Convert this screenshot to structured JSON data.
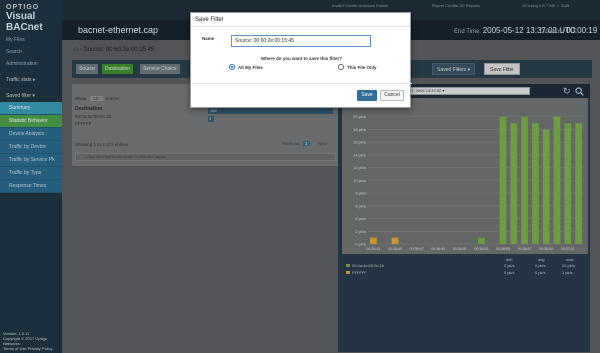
{
  "app": {
    "brand": "OPTIGO",
    "product": "Visual BACnet"
  },
  "topbar": {
    "info": [
      "Invalid Credits  Unknown Invalid",
      "Report Credits: 20 Reports",
      "10 Using 4 B 7 ME ✓ SUB"
    ]
  },
  "sidebar": {
    "items": [
      {
        "label": "My Files",
        "type": "nav"
      },
      {
        "label": "Search",
        "type": "nav"
      },
      {
        "label": "Administration",
        "type": "nav"
      },
      {
        "label": "Traffic stats ▸",
        "type": "section"
      },
      {
        "label": "Saved filter ▾",
        "type": "section"
      },
      {
        "label": "Summary",
        "type": "sub"
      },
      {
        "label": "Statistic Behavior",
        "type": "sub-green"
      },
      {
        "label": "Device Analysis",
        "type": "sub"
      },
      {
        "label": "Traffic by Device",
        "type": "sub"
      },
      {
        "label": "Traffic by Service Pk",
        "type": "sub"
      },
      {
        "label": "Traffic by Type",
        "type": "sub"
      },
      {
        "label": "Response Times",
        "type": "sub"
      }
    ],
    "footer": [
      "Version: 1.0.11",
      "Copyright © 2017 Optigo Networks",
      "Terms of Use Privacy Policy"
    ]
  },
  "file": {
    "name": "bacnet-ethernet.cap",
    "end_time_label": "End Time:",
    "end_time": "2005-05-12 13:37:02 UTC",
    "duration_label": "Duration:",
    "duration": "00:00:19"
  },
  "breadcrumb": {
    "text": "Source: 00:60:2e:00:15:45"
  },
  "tabs": [
    {
      "label": "Source",
      "selected": false
    },
    {
      "label": "Destination",
      "selected": true
    },
    {
      "label": "Service Choice",
      "selected": false
    }
  ],
  "toolbar": {
    "saved_filters": "Saved Filters ▾",
    "save_filter": "Save Filter"
  },
  "left_panel": {
    "show_prefix": "Show",
    "show_value": "10",
    "show_suffix": "entries",
    "header": "Destination",
    "rows": [
      "00:0a:4e:00:0c:1b",
      "FFFFFF"
    ],
    "col2_header": "Count",
    "col2_rows": [
      "159",
      "3"
    ],
    "footer": "Showing 1 to 2 of 2 entries",
    "pager": {
      "prev": "Previous",
      "page": "1",
      "next": "Next"
    },
    "filter_hint": "Click on a row to drill down or filter the report"
  },
  "chart_panel": {
    "date_range": "▦  May 12, 2005 13:36:43 - May 12, 2005 13:37:02 ▾",
    "legend": [
      {
        "label": "00:0a:4e:00:0c:1b",
        "color": "#7aa84a"
      },
      {
        "label": "FFFFFF",
        "color": "#d7a53a"
      }
    ],
    "stats_headers": [
      "min",
      "avg",
      "max"
    ],
    "stats_rows": [
      [
        "0 pk/s",
        "9 pk/s",
        "20 pk/s"
      ],
      [
        "0 pk/s",
        "0 pk/s",
        "1 pk/s"
      ]
    ]
  },
  "chart_data": {
    "type": "bar",
    "categories": [
      "13:36:43",
      "13:36:44",
      "13:36:45",
      "13:36:46",
      "13:36:47",
      "13:36:48",
      "13:36:49",
      "13:36:50",
      "13:36:51",
      "13:36:52",
      "13:36:53",
      "13:36:54",
      "13:36:55",
      "13:36:56",
      "13:36:57",
      "13:36:58",
      "13:36:59",
      "13:37:00",
      "13:37:01",
      "13:37:02"
    ],
    "x_tick_labels": [
      "00:36:43",
      "00:36:45",
      "00:36:47",
      "00:36:49",
      "00:36:51",
      "00:36:53",
      "00:36:55",
      "00:36:57",
      "00:36:59",
      "00:37:01"
    ],
    "series": [
      {
        "name": "00:0a:4e:00:0c:1b",
        "color": "#7ab04a",
        "values": [
          0,
          0,
          0,
          0,
          0,
          0,
          0,
          0,
          0,
          0,
          1,
          0,
          20,
          19,
          20,
          19,
          18,
          20,
          19,
          19
        ]
      },
      {
        "name": "FFFFFF",
        "color": "#e0a93a",
        "values": [
          1,
          0,
          1,
          0,
          0,
          0,
          0,
          0,
          0,
          0,
          0,
          0,
          0,
          0,
          0,
          0,
          0,
          0,
          0,
          0
        ]
      }
    ],
    "y_ticks": [
      "0 pk/s",
      "2 pk/s",
      "4 pk/s",
      "6 pk/s",
      "8 pk/s",
      "10 pk/s",
      "12 pk/s",
      "14 pk/s",
      "16 pk/s",
      "18 pk/s",
      "20 pk/s"
    ],
    "ylim": [
      0,
      22
    ]
  },
  "modal": {
    "title": "Save Filter",
    "name_label": "Name",
    "name_value": "Source: 00:60:2e:00:15:45",
    "question": "Where do you want to save this filter?",
    "options": [
      {
        "label": "All My Files",
        "selected": true
      },
      {
        "label": "This File Only",
        "selected": false
      }
    ],
    "save_label": "Save",
    "cancel_label": "Cancel"
  }
}
